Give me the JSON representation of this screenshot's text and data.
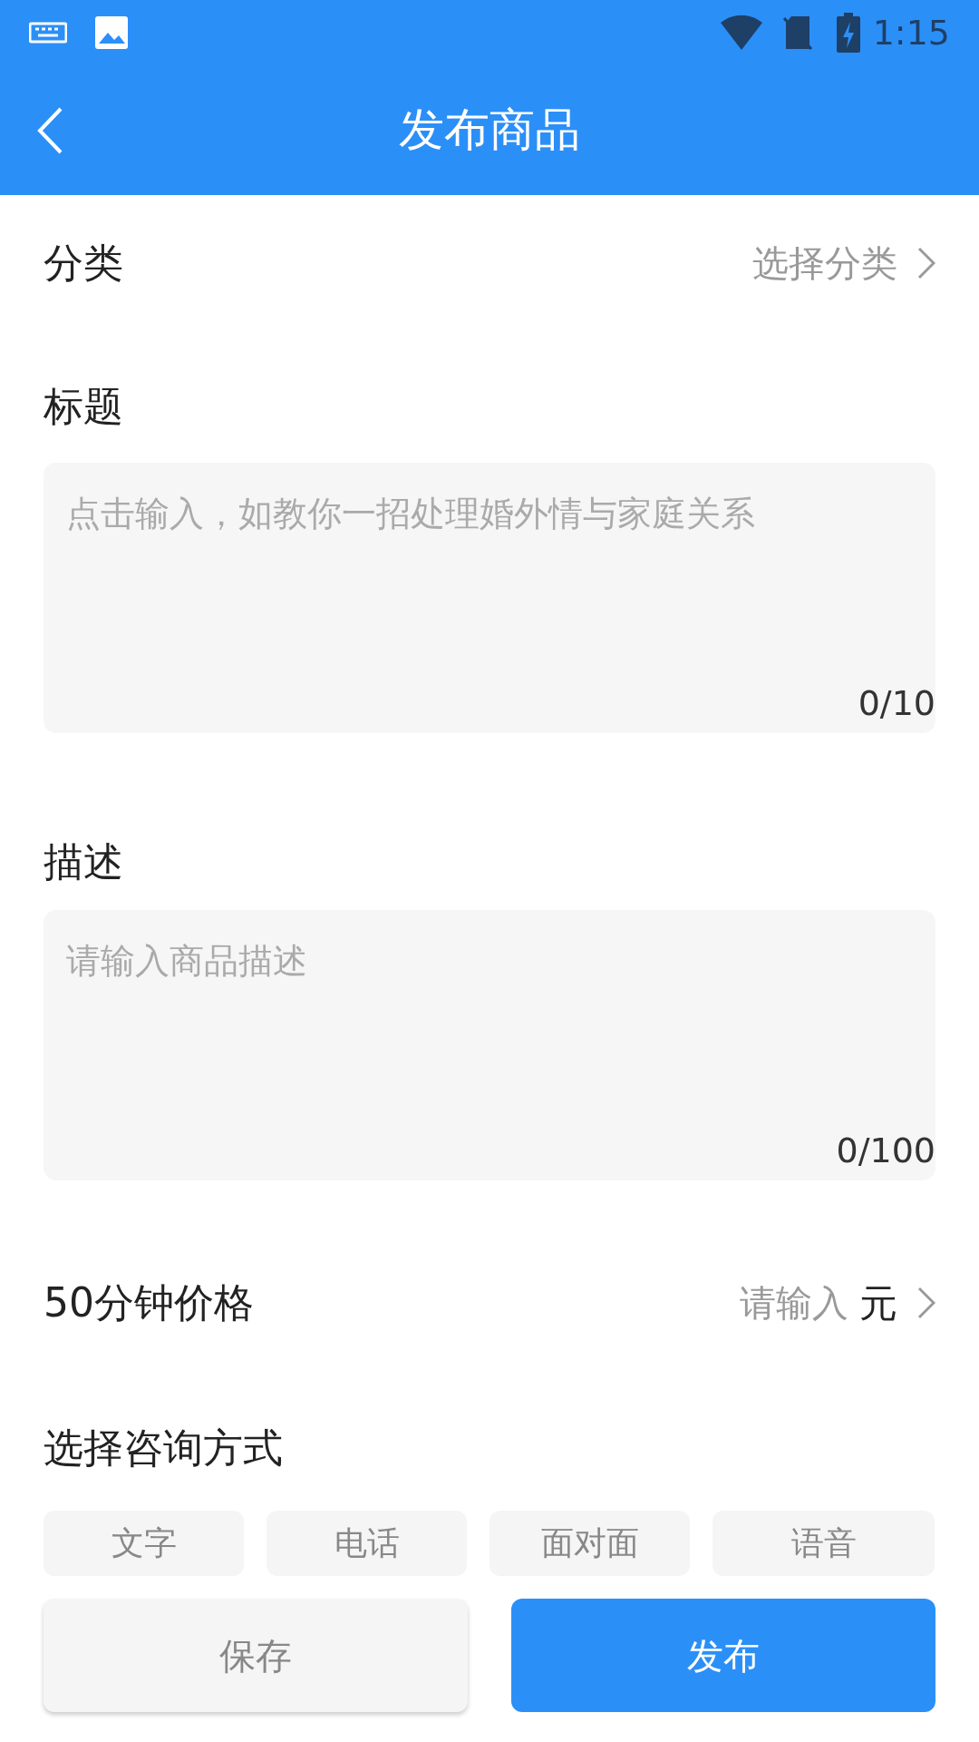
{
  "status_bar": {
    "time": "1:15"
  },
  "header": {
    "title": "发布商品"
  },
  "category": {
    "label": "分类",
    "value": "选择分类"
  },
  "title_field": {
    "label": "标题",
    "placeholder": "点击输入，如教你一招处理婚外情与家庭关系",
    "counter": "0/10"
  },
  "description_field": {
    "label": "描述",
    "placeholder": "请输入商品描述",
    "counter": "0/100"
  },
  "price": {
    "label": "50分钟价格",
    "placeholder": "请输入",
    "unit": "元"
  },
  "consult": {
    "label": "选择咨询方式",
    "options": [
      {
        "label": "文字",
        "selected": false
      },
      {
        "label": "电话",
        "selected": false
      },
      {
        "label": "面对面",
        "selected": false
      },
      {
        "label": "语音",
        "selected": false
      }
    ]
  },
  "buttons": {
    "save": "保存",
    "publish": "发布"
  }
}
